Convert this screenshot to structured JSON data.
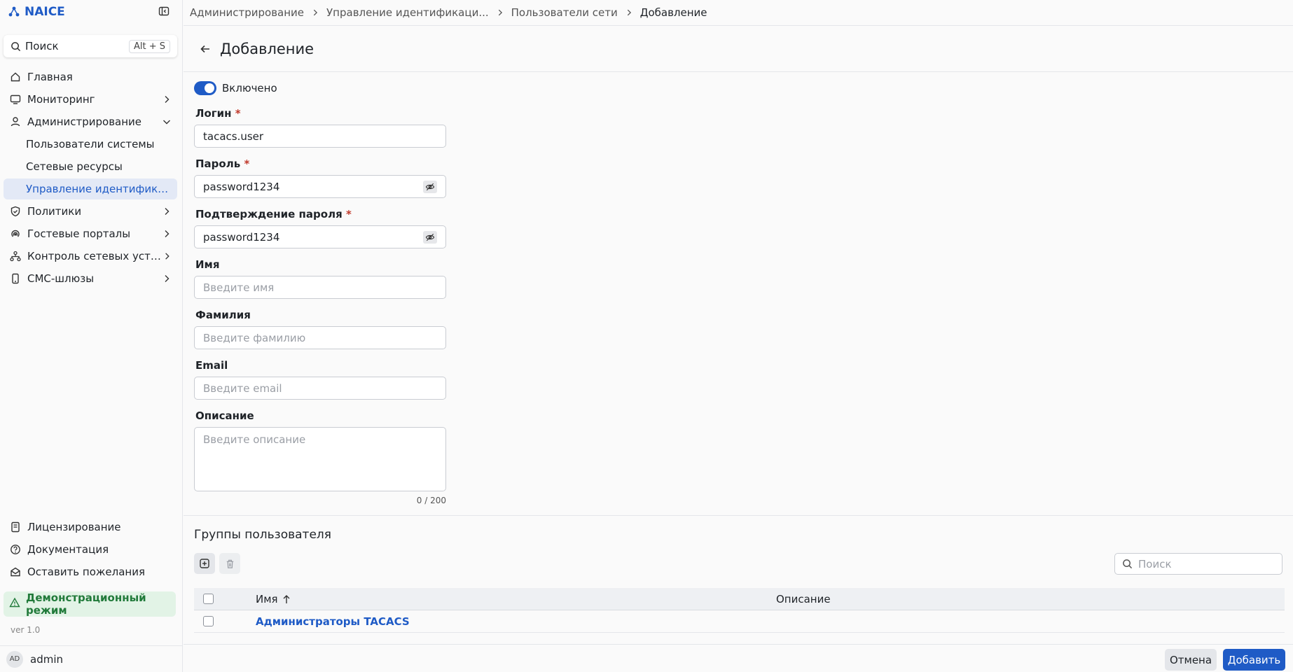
{
  "app": {
    "name": "NAICE"
  },
  "search": {
    "label": "Поиск",
    "shortcut": "Alt + S"
  },
  "nav": {
    "home": "Главная",
    "monitoring": "Мониторинг",
    "administration": "Администрирование",
    "sub_system_users": "Пользователи системы",
    "sub_network_resources": "Сетевые ресурсы",
    "sub_identity": "Управление идентификацией",
    "policies": "Политики",
    "guest_portals": "Гостевые порталы",
    "device_control": "Контроль сетевых устро...",
    "sms_gateways": "СМС-шлюзы",
    "licensing": "Лицензирование",
    "documentation": "Документация",
    "feedback": "Оставить пожелания"
  },
  "demo_mode": "Демонстрационный режим",
  "version": "ver 1.0",
  "user": {
    "initials": "AD",
    "name": "admin"
  },
  "breadcrumbs": {
    "c1": "Администрирование",
    "c2": "Управление идентификаци...",
    "c3": "Пользователи сети",
    "c4": "Добавление"
  },
  "page": {
    "title": "Добавление"
  },
  "form": {
    "enabled_label": "Включено",
    "enabled": true,
    "login_label": "Логин",
    "login_value": "tacacs.user",
    "password_label": "Пароль",
    "password_value": "password1234",
    "confirm_label": "Подтверждение пароля",
    "confirm_value": "password1234",
    "first_name_label": "Имя",
    "first_name_placeholder": "Введите имя",
    "last_name_label": "Фамилия",
    "last_name_placeholder": "Введите фамилию",
    "email_label": "Email",
    "email_placeholder": "Введите email",
    "description_label": "Описание",
    "description_placeholder": "Введите описание",
    "description_counter": "0 / 200",
    "required_mark": "*"
  },
  "groups": {
    "title": "Группы пользователя",
    "search_placeholder": "Поиск",
    "columns": {
      "name": "Имя",
      "description": "Описание"
    },
    "rows": [
      {
        "name": "Администраторы TACACS",
        "description": ""
      }
    ]
  },
  "footer": {
    "cancel": "Отмена",
    "add": "Добавить"
  },
  "colors": {
    "accent": "#1f5bc6",
    "demo_bg": "#e2f3e6",
    "demo_text": "#217a3a",
    "active_nav_bg": "#e3e9f6"
  }
}
